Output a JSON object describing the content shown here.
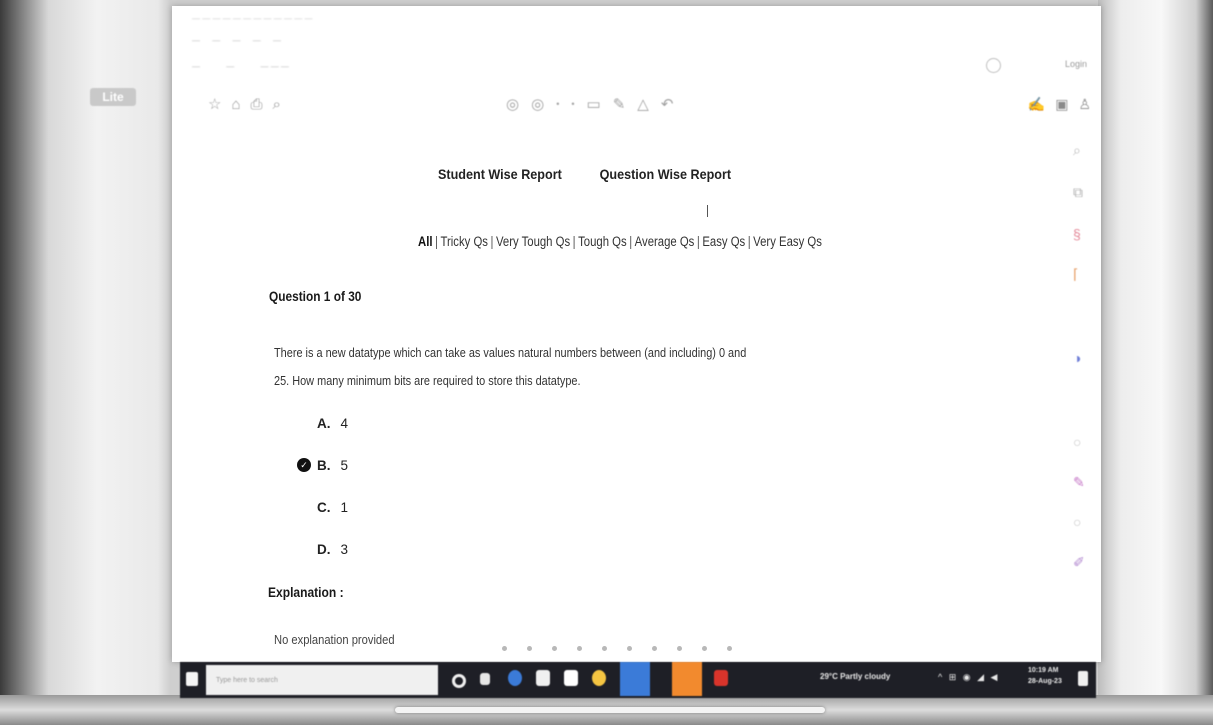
{
  "left_logo": {
    "text": "Lite"
  },
  "browser": {
    "title_text": "— — — — — — — — — — — —",
    "menu_items": [
      "—",
      "—",
      "—",
      "—",
      "—"
    ],
    "address_items": [
      "—",
      "—",
      "— — —"
    ],
    "login_label": "Login"
  },
  "pdf_toolbar": {
    "left_icons": [
      "star-icon",
      "home-icon",
      "print-icon",
      "search-icon"
    ],
    "mid_icons": [
      "circle-icon",
      "circle-icon",
      "dot-icon",
      "dot-icon",
      "comment-icon",
      "pen-icon",
      "highlighter-icon",
      "undo-icon"
    ],
    "right_icons": [
      "pen-icon",
      "panel-icon",
      "user-icon"
    ]
  },
  "report": {
    "tabs": [
      "Student Wise Report",
      "Question Wise Report"
    ],
    "filters": [
      {
        "label": "All",
        "active": true
      },
      {
        "label": "Tricky Qs",
        "active": false
      },
      {
        "label": "Very Tough Qs",
        "active": false
      },
      {
        "label": "Tough Qs",
        "active": false
      },
      {
        "label": "Average Qs",
        "active": false
      },
      {
        "label": "Easy Qs",
        "active": false
      },
      {
        "label": "Very Easy Qs",
        "active": false
      }
    ],
    "filter_separator": "|",
    "question_header": "Question 1 of 30",
    "question_line1": "There is a new datatype which can take as values natural numbers between (and including) 0 and",
    "question_line2": "25. How many minimum bits are required to store this datatype.",
    "options": [
      {
        "letter": "A.",
        "value": "4",
        "correct": false
      },
      {
        "letter": "B.",
        "value": "5",
        "correct": true
      },
      {
        "letter": "C.",
        "value": "1",
        "correct": false
      },
      {
        "letter": "D.",
        "value": "3",
        "correct": false
      }
    ],
    "correct_mark": "✓",
    "explanation_title": "Explanation :",
    "explanation_text": "No explanation provided"
  },
  "taskbar": {
    "search_placeholder": "Type here to search",
    "weather": "29°C Partly cloudy",
    "tray_icons": "^ ⊞ ◉ ◢ ◀",
    "clock_time": "10:19 AM",
    "clock_date": "28-Aug-23",
    "accent_colors": {
      "app_blue": "#3b7bd8",
      "app_orange": "#f28a2e",
      "app_red": "#d9342b",
      "app_yellow": "#f5c542"
    }
  }
}
